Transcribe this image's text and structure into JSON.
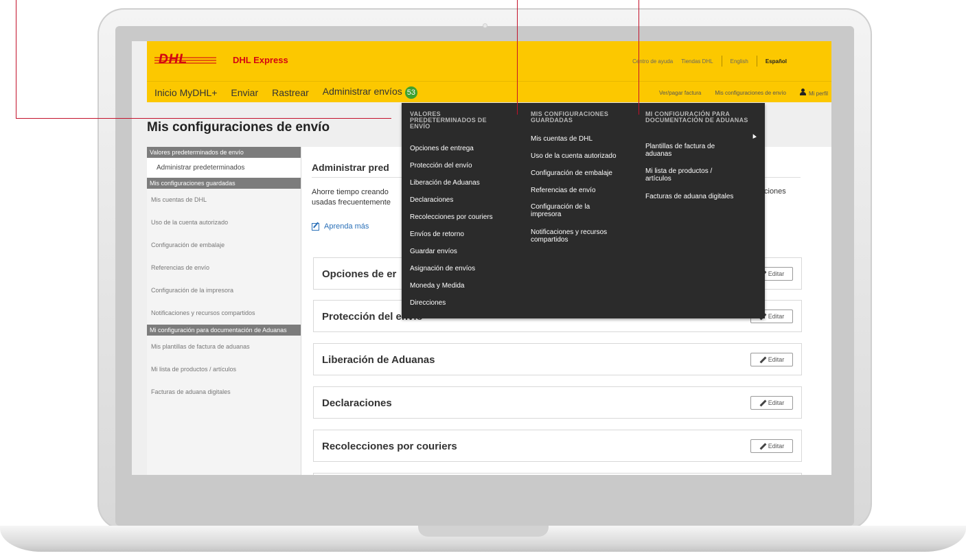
{
  "brand": {
    "logo_text": "DHL",
    "name": "DHL Express"
  },
  "utility_links": [
    "Centro de ayuda",
    "Tiendas DHL",
    "English",
    "Español"
  ],
  "nav": {
    "items": [
      "Inicio MyDHL+",
      "Enviar",
      "Rastrear",
      "Administrar envíos"
    ],
    "badge": "53",
    "right_links": [
      "Ver/pagar factura",
      "Mis configuraciones de envío",
      "Mi perfil"
    ]
  },
  "page_title": "Mis configuraciones de envío",
  "sidebar": {
    "section1": "Valores predeterminados de envío",
    "active_item": "Administrar predeterminados",
    "section2": "Mis configuraciones guardadas",
    "items2": [
      "Mis cuentas de DHL",
      "Uso de la cuenta autorizado",
      "Configuración de embalaje",
      "Referencias de envío",
      "Configuración de la impresora",
      "Notificaciones y recursos compartidos"
    ],
    "section3": "Mi configuración para documentación de Aduanas",
    "items3": [
      "Mis plantillas de factura de aduanas",
      "Mi lista de productos / artículos",
      "Facturas de aduana digitales"
    ]
  },
  "main": {
    "title": "Administrar pred",
    "text_line1": "Ahorre tiempo creando",
    "text_line2": "usadas frecuentemente",
    "text_right": "ciones",
    "learn_more": "Aprenda más",
    "edit_label": "Editar",
    "sections": [
      "Opciones de er",
      "Protección del envío",
      "Liberación de Aduanas",
      "Declaraciones",
      "Recolecciones por couriers"
    ]
  },
  "mega_menu": {
    "col1": {
      "heading": "VALORES PREDETERMINADOS DE ENVÍO",
      "items": [
        "Opciones de entrega",
        "Protección del envío",
        "Liberación de Aduanas",
        "Declaraciones",
        "Recolecciones por couriers",
        "Envíos de retorno",
        "Guardar envíos",
        "Asignación de envíos",
        "Moneda y Medida",
        "Direcciones"
      ]
    },
    "col2": {
      "heading": "MIS CONFIGURACIONES GUARDADAS",
      "items": [
        "Mis cuentas de DHL",
        "Uso de la cuenta autorizado",
        "Configuración de embalaje",
        "Referencias de envío",
        "Configuración de la impresora",
        "Notificaciones y recursos compartidos"
      ]
    },
    "col3": {
      "heading": "MI CONFIGURACIÓN PARA DOCUMENTACIÓN DE ADUANAS",
      "items": [
        "Plantillas de factura de aduanas",
        "Mi lista de productos / artículos",
        "Facturas de aduana digitales"
      ]
    }
  },
  "colors": {
    "dhl_yellow": "#fcc800",
    "dhl_red": "#d40511",
    "menu_bg": "#2b2b2b",
    "callout": "#c3102a"
  }
}
